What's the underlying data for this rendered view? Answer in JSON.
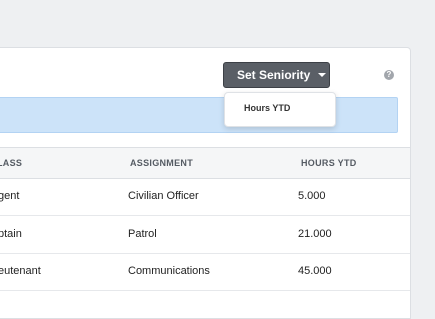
{
  "toolbar": {
    "seniority_label": "Set Seniority",
    "help_glyph": "?"
  },
  "dropdown": {
    "items": [
      {
        "label": "Hours YTD"
      }
    ]
  },
  "table": {
    "headers": [
      "LASS",
      "ASSIGNMENT",
      "HOURS YTD"
    ],
    "rows": [
      {
        "class": "gent",
        "assignment": "Civilian Officer",
        "hours": "5.000"
      },
      {
        "class": "ptain",
        "assignment": "Patrol",
        "hours": "21.000"
      },
      {
        "class": "eutenant",
        "assignment": "Communications",
        "hours": "45.000"
      }
    ]
  },
  "colors": {
    "button": "#5a5f66",
    "info_bar": "#cce3f9",
    "header_bg": "#f5f6f7"
  }
}
